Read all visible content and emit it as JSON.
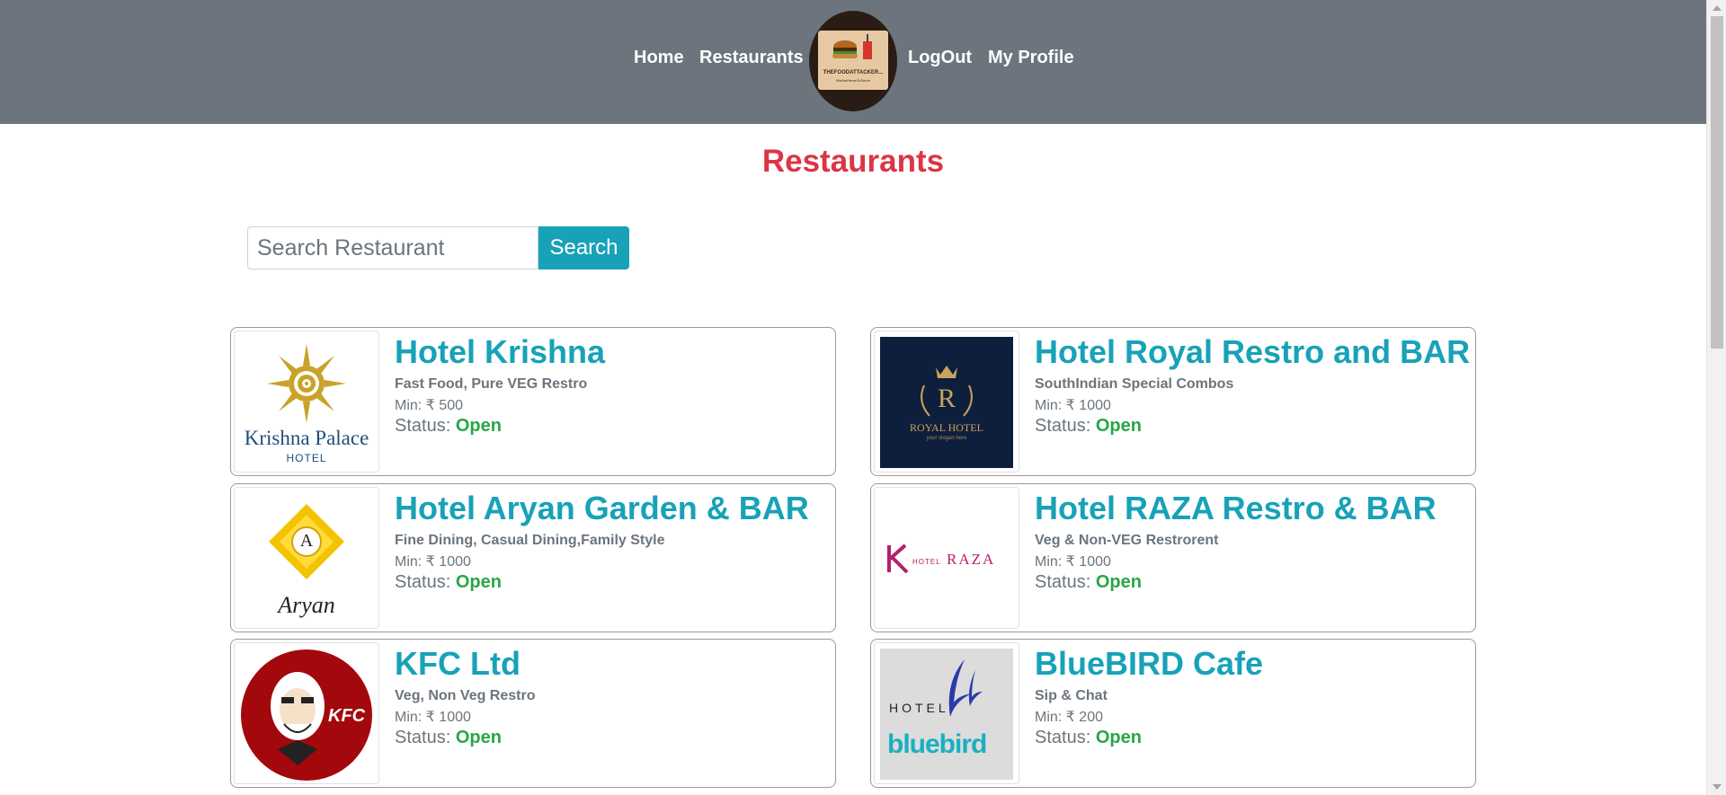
{
  "nav": {
    "home": "Home",
    "restaurants": "Restaurants",
    "logout": "LogOut",
    "profile": "My Profile",
    "logo_text": "THEFOODATTACKER...",
    "logo_subtext": "WeAreHereeToServe"
  },
  "page": {
    "title": "Restaurants"
  },
  "search": {
    "placeholder": "Search Restaurant",
    "button_label": "Search"
  },
  "restaurants": [
    {
      "name": "Hotel Krishna",
      "cuisine": "Fast Food, Pure VEG Restro",
      "min": "Min: ₹ 500",
      "status_label": "Status:",
      "status": "Open",
      "logo_text": "Krishna Palace",
      "logo_sub": "HOTEL"
    },
    {
      "name": "Hotel Royal Restro and BAR",
      "cuisine": "SouthIndian Special Combos",
      "min": "Min: ₹ 1000",
      "status_label": "Status:",
      "status": "Open",
      "logo_text": "ROYAL HOTEL",
      "logo_sub": "your slogan here",
      "logo_letter": "R"
    },
    {
      "name": "Hotel Aryan Garden & BAR",
      "cuisine": "Fine Dining, Casual Dining,Family Style",
      "min": "Min: ₹ 1000",
      "status_label": "Status:",
      "status": "Open",
      "logo_text": "Aryan",
      "logo_letter": "A"
    },
    {
      "name": "Hotel RAZA Restro & BAR",
      "cuisine": "Veg & Non-VEG Restrorent",
      "min": "Min: ₹ 1000",
      "status_label": "Status:",
      "status": "Open",
      "logo_text": "RAZA",
      "logo_sub": "HOTEL"
    },
    {
      "name": "KFC Ltd",
      "cuisine": "Veg, Non Veg Restro",
      "min": "Min: ₹ 1000",
      "status_label": "Status:",
      "status": "Open",
      "logo_text": "KFC"
    },
    {
      "name": "BlueBIRD Cafe",
      "cuisine": "Sip & Chat",
      "min": "Min: ₹ 200",
      "status_label": "Status:",
      "status": "Open",
      "logo_text": "bluebird",
      "logo_sub": "HOTEL"
    }
  ],
  "colors": {
    "navbar": "#6c757d",
    "title": "#dc3545",
    "accent": "#17a2b8",
    "open": "#28a745"
  }
}
